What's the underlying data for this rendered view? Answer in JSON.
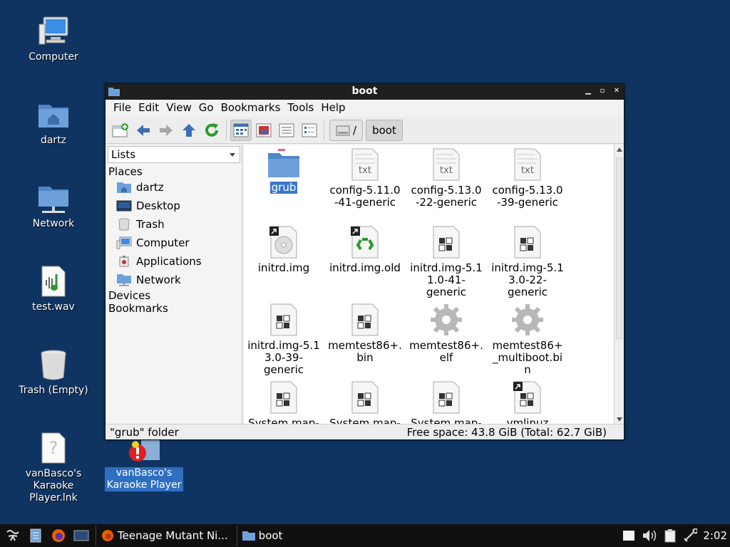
{
  "desktop": {
    "icons": [
      {
        "label": "Computer",
        "icon": "computer-icon"
      },
      {
        "label": "dartz",
        "icon": "home-folder-icon"
      },
      {
        "label": "Network",
        "icon": "network-folder-icon"
      },
      {
        "label": "test.wav",
        "icon": "audio-file-icon"
      },
      {
        "label": "Trash (Empty)",
        "icon": "trash-icon"
      },
      {
        "label": "vanBasco's\nKaraoke\nPlayer.lnk",
        "icon": "unknown-file-icon"
      },
      {
        "label": "vanBasco's\nKaraoke Player",
        "icon": "karaoke-app-icon"
      }
    ]
  },
  "window": {
    "title": "boot",
    "menu": [
      "File",
      "Edit",
      "View",
      "Go",
      "Bookmarks",
      "Tools",
      "Help"
    ],
    "toolbar": {
      "buttons": [
        "new-tab-icon",
        "back-icon",
        "forward-icon",
        "up-icon",
        "reload-icon",
        "icon-view-icon",
        "thumbnail-view-icon",
        "compact-view-icon",
        "detail-view-icon"
      ],
      "path": [
        "/",
        "boot"
      ]
    },
    "sidebar": {
      "mode": "Lists",
      "places_heading": "Places",
      "places": [
        "dartz",
        "Desktop",
        "Trash",
        "Computer",
        "Applications",
        "Network"
      ],
      "devices_heading": "Devices",
      "bookmarks_heading": "Bookmarks"
    },
    "files": [
      {
        "name": "grub",
        "type": "folder",
        "selected": true
      },
      {
        "name": "config-5.11.0\n-41-generic",
        "type": "text"
      },
      {
        "name": "config-5.13.0\n-22-generic",
        "type": "text"
      },
      {
        "name": "config-5.13.0\n-39-generic",
        "type": "text"
      },
      {
        "name": "initrd.img",
        "type": "link-disc"
      },
      {
        "name": "initrd.img.old",
        "type": "link-recycle"
      },
      {
        "name": "initrd.img-5.1\n1.0-41-\ngeneric",
        "type": "binary"
      },
      {
        "name": "initrd.img-5.1\n3.0-22-\ngeneric",
        "type": "binary"
      },
      {
        "name": "initrd.img-5.1\n3.0-39-\ngeneric",
        "type": "binary"
      },
      {
        "name": "memtest86+.\nbin",
        "type": "binary"
      },
      {
        "name": "memtest86+.\nelf",
        "type": "gear"
      },
      {
        "name": "memtest86+\n_multiboot.bi\nn",
        "type": "gear"
      },
      {
        "name": "System.map-",
        "type": "binary"
      },
      {
        "name": "System.map-",
        "type": "binary"
      },
      {
        "name": "System.map-",
        "type": "binary"
      },
      {
        "name": "vmlinuz",
        "type": "link-binary"
      }
    ],
    "status": {
      "left": "\"grub\" folder",
      "right": "Free space: 43.8 GiB (Total: 62.7 GiB)"
    }
  },
  "taskbar": {
    "tasks": [
      "Teenage Mutant Ni...",
      "boot"
    ],
    "clock": "2:02"
  }
}
